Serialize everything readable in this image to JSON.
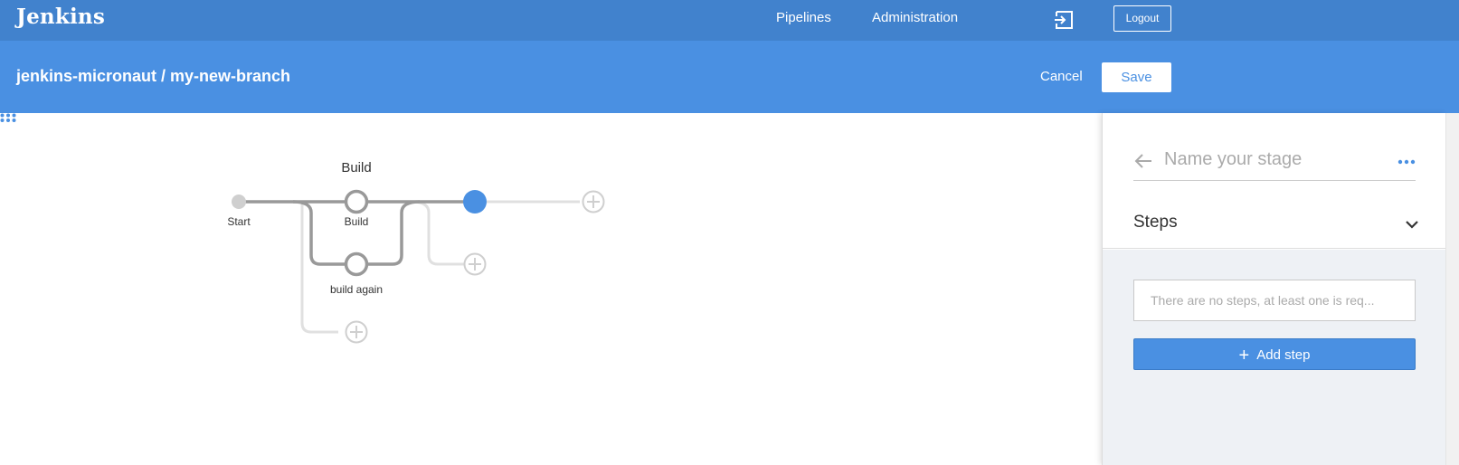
{
  "topbar": {
    "logo": "Jenkins",
    "nav": {
      "pipelines": "Pipelines",
      "administration": "Administration"
    },
    "logout_label": "Logout",
    "exit_icon": "exit-icon"
  },
  "subbar": {
    "breadcrumb": "jenkins-micronaut / my-new-branch",
    "cancel_label": "Cancel",
    "save_label": "Save"
  },
  "pipeline": {
    "stage_title": "Build",
    "nodes": {
      "start": "Start",
      "build": "Build",
      "build_again": "build again"
    },
    "colors": {
      "line": "#999999",
      "node_selected": "#4a90e2",
      "add": "#d0d0d0"
    }
  },
  "panel": {
    "stage_name_placeholder": "Name your stage",
    "steps_title": "Steps",
    "steps_empty_message": "There are no steps, at least one is req...",
    "add_step_label": "Add step"
  },
  "colors": {
    "topbar": "#4182cd",
    "subbar": "#4a90e2",
    "accent": "#4a90e2"
  }
}
